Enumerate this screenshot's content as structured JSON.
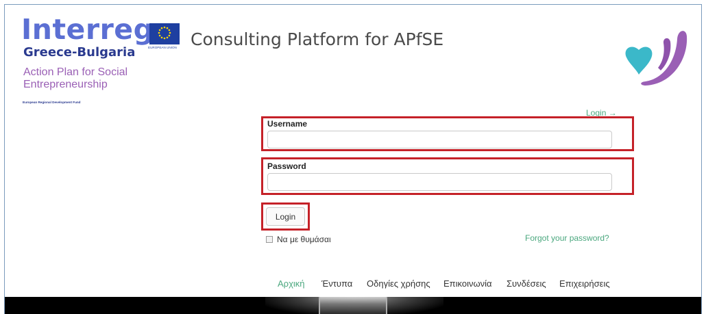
{
  "brand": {
    "name": "Interreg",
    "region": "Greece-Bulgaria",
    "plan": "Action Plan for Social Entrepreneurship",
    "fund": "European Regional Development Fund"
  },
  "eu": {
    "caption": "EUROPEAN UNION"
  },
  "header": {
    "title": "Consulting Platform for APfSE"
  },
  "colors": {
    "accent": "#4aa77e",
    "highlight": "#c52128",
    "brand_blue": "#5b6fd3",
    "brand_purple": "#9a5fb5"
  },
  "login_form": {
    "top_link": "Login →",
    "username_label": "Username",
    "username_value": "",
    "password_label": "Password",
    "password_value": "",
    "submit_label": "Login",
    "remember_label": "Να με θυμάσαι",
    "forgot_label": "Forgot your password?"
  },
  "nav": {
    "items": [
      {
        "label": "Αρχική",
        "active": true
      },
      {
        "label": "Έντυπα",
        "active": false
      },
      {
        "label": "Οδηγίες χρήσης",
        "active": false
      },
      {
        "label": "Επικοινωνία",
        "active": false
      },
      {
        "label": "Συνδέσεις",
        "active": false
      },
      {
        "label": "Επιχειρήσεις",
        "active": false
      }
    ]
  }
}
